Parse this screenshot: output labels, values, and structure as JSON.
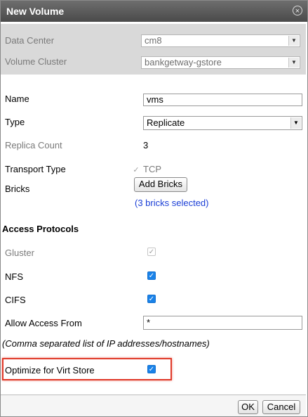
{
  "dialog": {
    "title": "New Volume",
    "close_icon": "×"
  },
  "top": {
    "data_center_label": "Data Center",
    "data_center_value": "cm8",
    "volume_cluster_label": "Volume Cluster",
    "volume_cluster_value": "bankgetway-gstore"
  },
  "form": {
    "name_label": "Name",
    "name_value": "vms",
    "type_label": "Type",
    "type_value": "Replicate",
    "replica_label": "Replica Count",
    "replica_value": "3",
    "transport_label": "Transport Type",
    "transport_value": "TCP",
    "bricks_label": "Bricks",
    "add_bricks_label": "Add Bricks",
    "bricks_selected": "(3 bricks selected)"
  },
  "access": {
    "section_title": "Access Protocols",
    "gluster_label": "Gluster",
    "nfs_label": "NFS",
    "cifs_label": "CIFS",
    "allow_access_label": "Allow Access From",
    "allow_access_value": "*",
    "hint": "(Comma separated list of IP addresses/hostnames)"
  },
  "virt": {
    "optimize_label": "Optimize for Virt Store"
  },
  "footer": {
    "ok_label": "OK",
    "cancel_label": "Cancel"
  },
  "colors": {
    "checkbox_accent": "#1a82e8",
    "link": "#1a3ed6",
    "highlight": "#e03a2a"
  },
  "icons": {
    "check": "✓",
    "dropdown": "▼"
  }
}
